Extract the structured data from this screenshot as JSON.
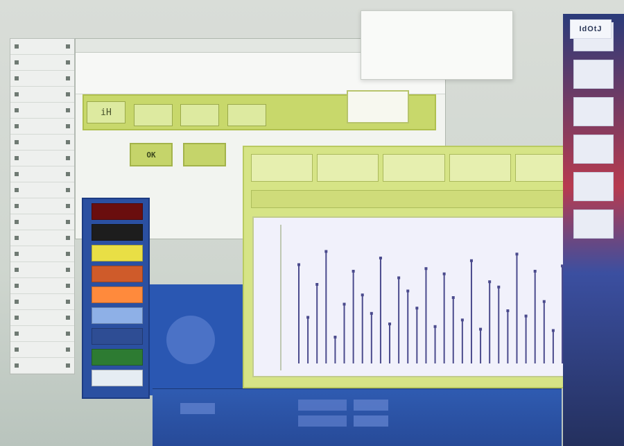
{
  "brand": {
    "logo_text": "IdOtJ"
  },
  "colors": {
    "accent": "#c8d86b",
    "panel_blue": "#2b50a1",
    "plot_bg": "#f1f1fb"
  },
  "toolbar": {
    "icon_labels": [
      "iH",
      "",
      "",
      ""
    ],
    "primary_label": "OK",
    "secondary_label": ""
  },
  "palette": {
    "swatches": [
      "#6a0e0e",
      "#1d1d1d",
      "#e9df45",
      "#cf5b2a",
      "#ff8a3c",
      "#8eb0e7",
      "#2e4d94",
      "#2d7b32",
      "#e6edf3"
    ]
  },
  "plot": {
    "tabs": [
      "",
      "",
      "",
      "",
      ""
    ],
    "series_colors": [
      "#4b4b8d",
      "#c8d86b"
    ]
  },
  "chart_data": {
    "type": "scatter",
    "title": "",
    "xlabel": "",
    "ylabel": "",
    "series": [
      {
        "values": [
          0.75,
          0.35,
          0.6,
          0.85,
          0.2,
          0.45,
          0.7,
          0.52,
          0.38,
          0.8,
          0.3,
          0.65,
          0.55,
          0.42,
          0.72,
          0.28,
          0.68,
          0.5,
          0.33,
          0.78,
          0.26,
          0.62,
          0.58,
          0.4,
          0.83,
          0.36,
          0.7,
          0.47,
          0.25,
          0.74
        ]
      }
    ]
  }
}
